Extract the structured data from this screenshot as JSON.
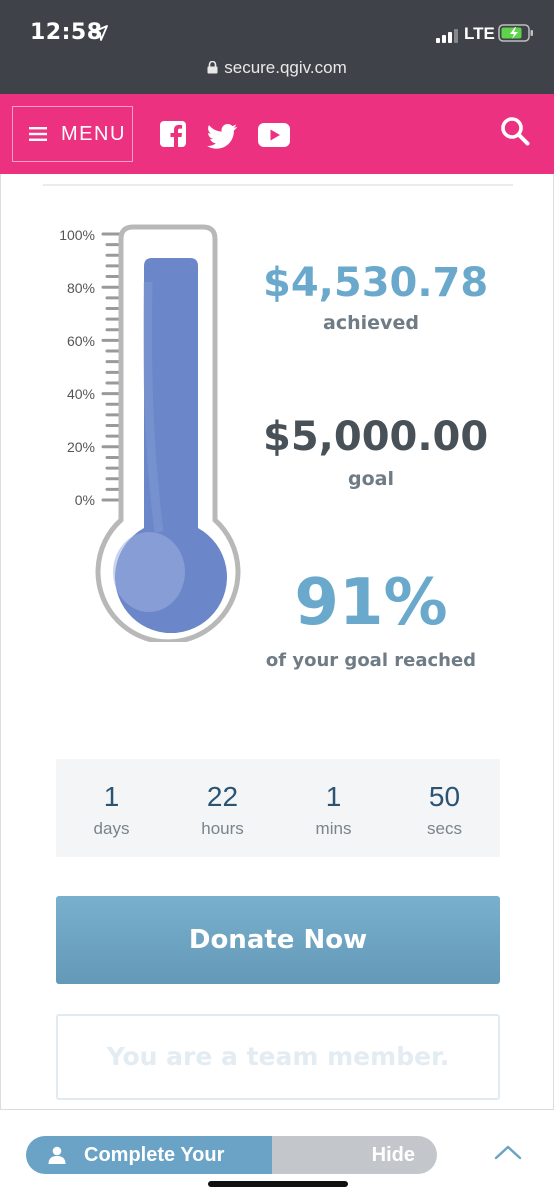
{
  "status_bar": {
    "time": "12:58",
    "network": "LTE",
    "url": "secure.qgiv.com"
  },
  "nav": {
    "menu_label": "MENU"
  },
  "thermometer": {
    "ticks": [
      "100%",
      "80%",
      "60%",
      "40%",
      "20%",
      "0%"
    ],
    "fill_fraction": 0.91,
    "colors": {
      "fill": "#6b86c9",
      "outline": "#b8b8b8"
    }
  },
  "stats": {
    "achieved_amount": "$4,530.78",
    "achieved_label": "achieved",
    "goal_amount": "$5,000.00",
    "goal_label": "goal",
    "percent": "91%",
    "percent_label": "of your goal reached"
  },
  "countdown": [
    {
      "value": "1",
      "unit": "days"
    },
    {
      "value": "22",
      "unit": "hours"
    },
    {
      "value": "1",
      "unit": "mins"
    },
    {
      "value": "50",
      "unit": "secs"
    }
  ],
  "donate_label": "Donate Now",
  "team_label": "You are a team member.",
  "bottom": {
    "complete_label": "Complete Your",
    "hide_label": "Hide"
  },
  "colors": {
    "brand_pink": "#ec3181",
    "accent_blue": "#6aa9cc"
  }
}
